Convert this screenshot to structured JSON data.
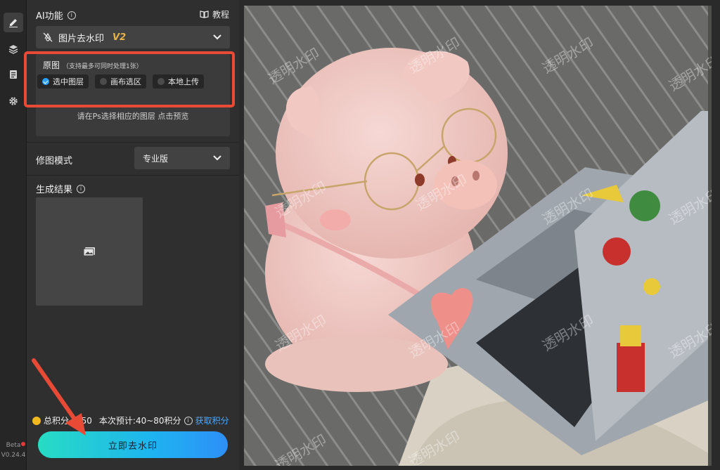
{
  "rail": {
    "beta": "Beta",
    "version": "V0.24.4"
  },
  "header": {
    "title": "AI功能",
    "tutorial": "教程"
  },
  "function_select": {
    "label": "图片去水印",
    "version": "V2"
  },
  "original": {
    "label": "原图",
    "sub": "（支持最多可同时处理1张）",
    "options": [
      "选中图层",
      "画布选区",
      "本地上传"
    ],
    "selected": "选中图层",
    "hint": "请在Ps选择相应的图层 点击预览"
  },
  "mode": {
    "label": "修图模式",
    "value": "专业版"
  },
  "result": {
    "label": "生成结果"
  },
  "footer": {
    "points_label": "总积分",
    "points_value": "450",
    "estimate": "本次预计:40~80积分",
    "get_points": "获取积分",
    "action": "立即去水印"
  },
  "watermark_text": "透明水印",
  "colors": {
    "accent": "#2aa1ff",
    "highlight_frame": "#e84a35",
    "button_start": "#27dcc4",
    "button_end": "#2d8ff7",
    "coin": "#f2b820"
  }
}
